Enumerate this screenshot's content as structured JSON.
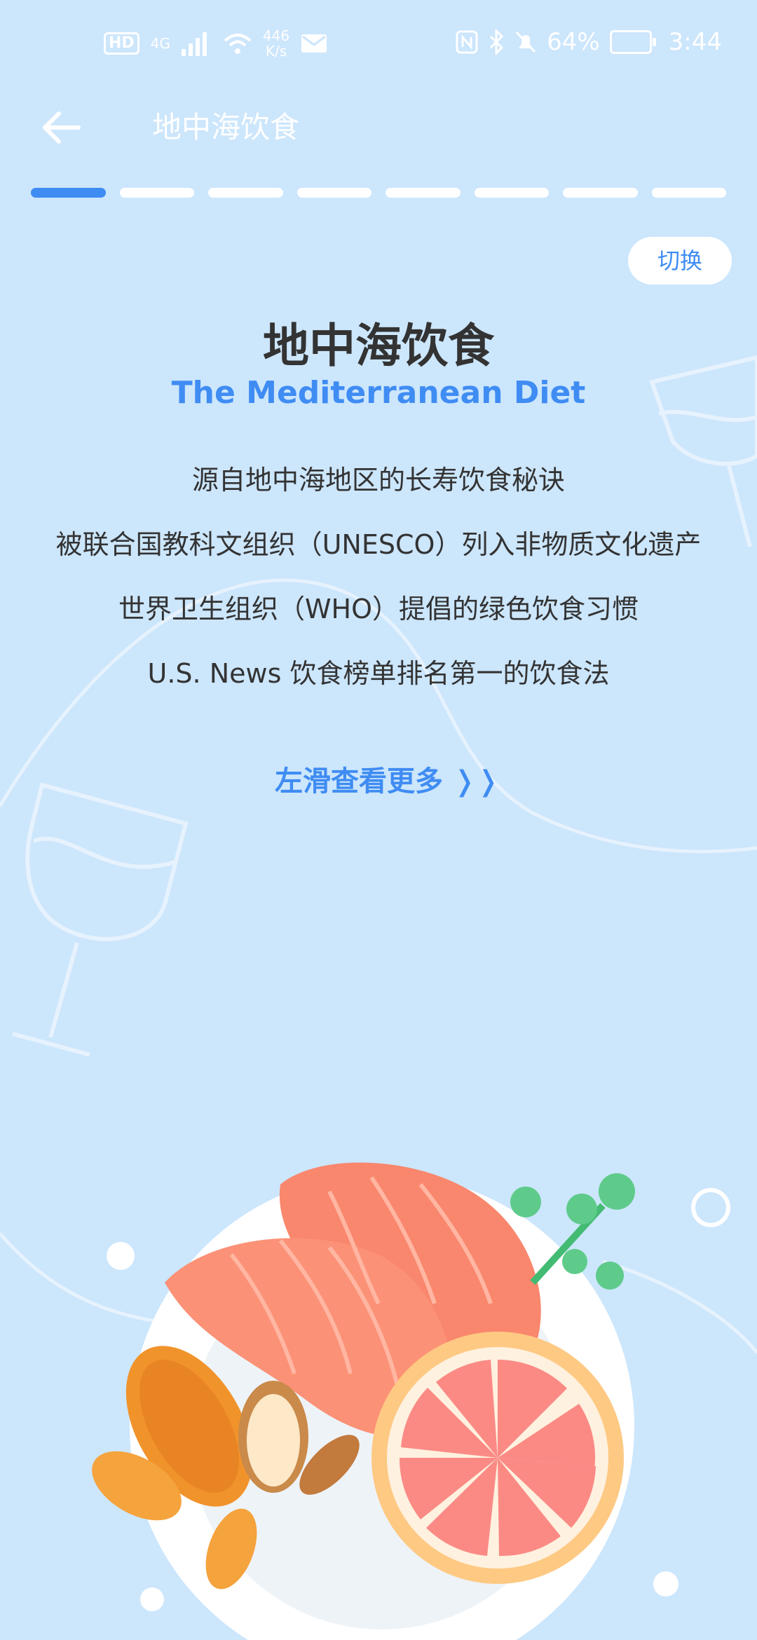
{
  "status_bar": {
    "hd": "HD",
    "network": "4G",
    "speed_value": "446",
    "speed_unit": "K/s",
    "battery": "64%",
    "time": "3:44"
  },
  "header": {
    "title": "地中海饮食"
  },
  "progress": {
    "total_pages": 8,
    "current_page": 1
  },
  "switch_label": "切换",
  "content": {
    "title": "地中海饮食",
    "subtitle": "The Mediterranean Diet",
    "lines": [
      "源自地中海地区的长寿饮食秘诀",
      "被联合国教科文组织（UNESCO）列入非物质文化遗产",
      "世界卫生组织（WHO）提倡的绿色饮食习惯",
      "U.S. News 饮食榜单排名第一的饮食法"
    ],
    "swipe_hint": "左滑查看更多 ❭❭"
  },
  "colors": {
    "background": "#cce6fc",
    "accent": "#3f8cf3",
    "text": "#333333"
  }
}
